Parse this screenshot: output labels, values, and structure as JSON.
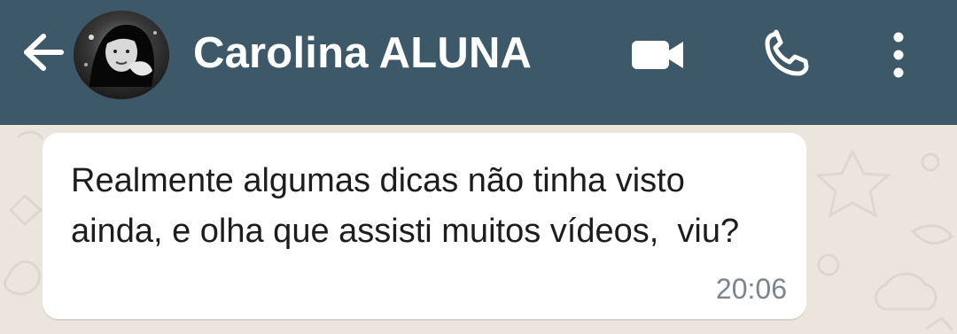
{
  "header": {
    "contact_name": "Carolina ALUNA",
    "icons": {
      "back": "back-arrow-icon",
      "video": "video-camera-icon",
      "call": "phone-icon",
      "menu": "more-vertical-icon"
    }
  },
  "message": {
    "text": "Realmente algumas dicas não tinha visto ainda, e olha que assisti muitos vídeos,  viu?",
    "time": "20:06"
  },
  "colors": {
    "topbar": "#3d5868",
    "chat_background": "#ece5dd",
    "bubble": "#ffffff",
    "timestamp": "#7c858d"
  }
}
